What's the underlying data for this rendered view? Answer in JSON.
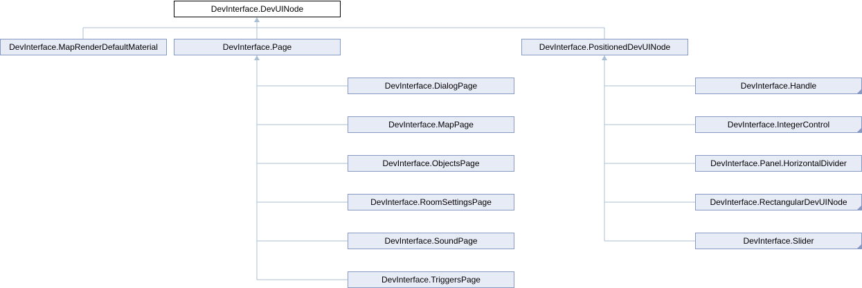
{
  "root": {
    "label": "DevInterface.DevUINode"
  },
  "level1": {
    "map_render": {
      "label": "DevInterface.MapRenderDefaultMaterial"
    },
    "page": {
      "label": "DevInterface.Page"
    },
    "positioned": {
      "label": "DevInterface.PositionedDevUINode"
    }
  },
  "page_children": [
    {
      "label": "DevInterface.DialogPage"
    },
    {
      "label": "DevInterface.MapPage"
    },
    {
      "label": "DevInterface.ObjectsPage"
    },
    {
      "label": "DevInterface.RoomSettingsPage"
    },
    {
      "label": "DevInterface.SoundPage"
    },
    {
      "label": "DevInterface.TriggersPage"
    }
  ],
  "positioned_children": [
    {
      "label": "DevInterface.Handle"
    },
    {
      "label": "DevInterface.IntegerControl"
    },
    {
      "label": "DevInterface.Panel.HorizontalDivider"
    },
    {
      "label": "DevInterface.RectangularDevUINode"
    },
    {
      "label": "DevInterface.Slider"
    }
  ],
  "colors": {
    "node_fill": "#e7ebf5",
    "node_border": "#8597c3",
    "root_fill": "#ffffff",
    "root_border": "#000000",
    "edge": "#a9bfd6"
  }
}
